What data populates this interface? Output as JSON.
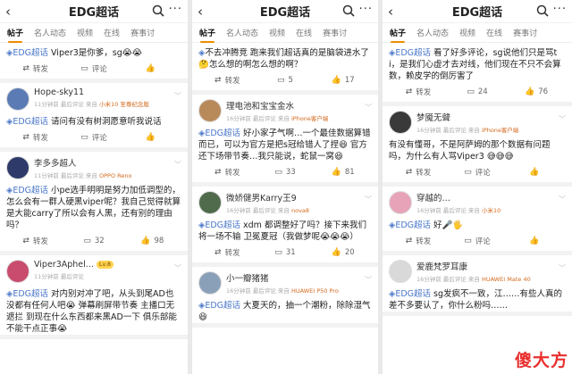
{
  "common": {
    "title": "EDG超话",
    "tabs": [
      "帖子",
      "名人动态",
      "视频",
      "在线",
      "赛事讨"
    ],
    "actions": {
      "repost": "转发",
      "comment": "评论"
    },
    "more": "···",
    "back": "‹",
    "chevron": "﹀"
  },
  "panels": [
    {
      "posts": [
        {
          "partial": true,
          "tag": "EDG超话",
          "text": " Viper3是你爹，sg😭😭",
          "repost": "转发",
          "comments": "评论",
          "likes": ""
        },
        {
          "user": "Hope-sky11",
          "badge": "",
          "meta": "11分钟前 最后评论  来自 ",
          "device": "小米10 至尊纪念版",
          "tag": "EDG超话",
          "text": " 请问有没有树洞愿意听我说话",
          "repost": "转发",
          "comments": "评论",
          "likes": "",
          "avatar_color": "#5b7bb5"
        },
        {
          "user": "李多多超人",
          "badge": "",
          "meta": "11分钟前 最后评论  来自 ",
          "device": "OPPO Reno",
          "tag": "EDG超话",
          "text": " 小pe选手明明是努力加低调型的，怎么会有一群人硬黑viper呢？我自己觉得就算是大能carry了所以会有人黑，还有别的理由吗？",
          "repost": "转发",
          "comments": "32",
          "likes": "98",
          "avatar_color": "#2d3a6a"
        },
        {
          "user": "Viper3Aphel...",
          "badge": "Lv.8",
          "meta": "11分钟前 最后评论",
          "device": "",
          "tag": "EDG超话",
          "text": " 对内别对冲了吧，从头到尾AD也没都有任何人吧😭 弹幕刷屏带节奏 主播口无遮拦 到现在什么东西都来黑AD一下 俱乐部能不能干点正事😭",
          "repost": "",
          "comments": "",
          "likes": "",
          "avatar_color": "#c94b6d"
        }
      ]
    },
    {
      "posts": [
        {
          "partial": true,
          "tag": "",
          "text": "不去冲腾竞 跑来我们超话真的是脑袋进水了🤔怎么想的啊怎么想的啊？",
          "repost": "转发",
          "comments": "5",
          "likes": "17"
        },
        {
          "user": "理电池和宝宝金水",
          "badge": "",
          "meta": "16分钟前 最后评论  来自 ",
          "device": "iPhone客户端",
          "tag": "EDG超话",
          "text": " 好小家子气啊…一个最佳数据算错而已，可以为官方是把s冠给错人了捏😆 官方还下场带节奏…我只能说，蛇鼠一窝😆",
          "repost": "转发",
          "comments": "33",
          "likes": "81",
          "avatar_color": "#b88a5a"
        },
        {
          "user": "微娇健男Karry王9",
          "badge": "",
          "meta": "16分钟前 最后评论  来自 ",
          "device": "nova8",
          "tag": "EDG超话",
          "text": " xdm 都调整好了吗？接下来我们将一场不输 卫冕夏冠（我做梦呢😭😭😭）",
          "repost": "转发",
          "comments": "31",
          "likes": "20",
          "avatar_color": "#4f6b4b"
        },
        {
          "user": "小一瓣猪猪",
          "badge": "",
          "meta": "16分钟前 最后评论  来自 ",
          "device": "HUAWEI P50 Pro",
          "tag": "EDG超话",
          "text": " 大夏天的，抽一个潮粉，除除湿气😆",
          "repost": "",
          "comments": "",
          "likes": "",
          "avatar_color": "#8aa0b8"
        }
      ]
    },
    {
      "posts": [
        {
          "partial": true,
          "tag": "EDG超话",
          "text": " 看了好多评论，sg说他们只是骂ti，是我们心虚才去对线，他们现在不只不会算数，赖皮学的倒厉害了",
          "repost": "转发",
          "comments": "24",
          "likes": "76"
        },
        {
          "user": "梦魇无聲",
          "badge": "",
          "meta": "16分钟前 最后评论  来自 ",
          "device": "iPhone客户端",
          "tag": "",
          "text": "有没有懂哥，不是阿萨姆的那个数据有问题吗，为什么有人骂Viper3 😅😅😅",
          "repost": "转发",
          "comments": "评论",
          "likes": "",
          "avatar_color": "#3a3a3a"
        },
        {
          "user": "穿越的…",
          "badge": "",
          "meta": "16分钟前 最后评论  来自 ",
          "device": "小米10",
          "tag": "EDG超话",
          "text": " 好🎤🖐",
          "repost": "转发",
          "comments": "评论",
          "likes": "",
          "avatar_color": "#e7a3b8"
        },
        {
          "user": "爱鹿梵罗耳康",
          "badge": "",
          "meta": "16分钟前 最后评论  来自 ",
          "device": "HUAWEI Mate 40",
          "tag": "EDG超话",
          "text": " sg发疯不一致，江……有些人真的差不多要认了，你什么粉吗……",
          "repost": "",
          "comments": "",
          "likes": "",
          "avatar_color": "#d9d9d9"
        }
      ]
    }
  ],
  "watermark": "傻大方",
  "colors": {
    "accent": "#f08c00",
    "tag": "#4a77c9",
    "watermark": "#e8302f"
  }
}
